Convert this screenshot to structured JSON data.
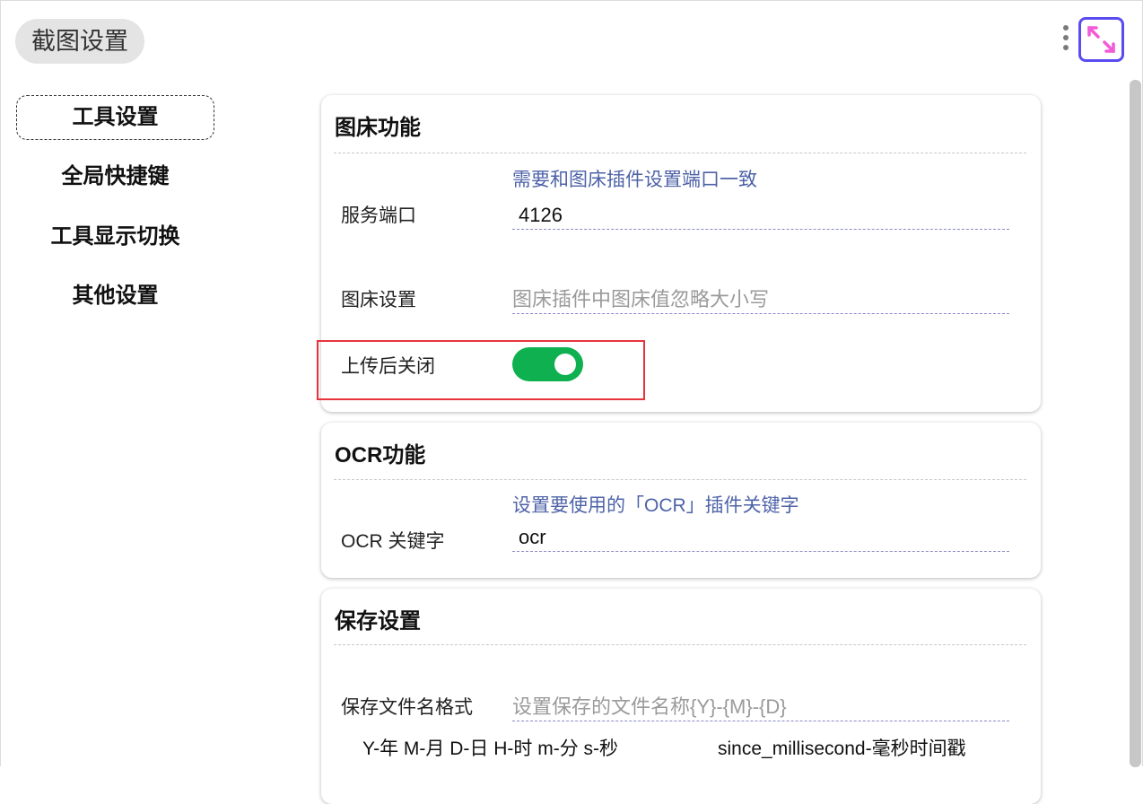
{
  "header": {
    "title": "截图设置"
  },
  "sidebar": {
    "items": [
      {
        "label": "工具设置",
        "active": true
      },
      {
        "label": "全局快捷键",
        "active": false
      },
      {
        "label": "工具显示切换",
        "active": false
      },
      {
        "label": "其他设置",
        "active": false
      }
    ]
  },
  "sections": {
    "image_bed": {
      "title": "图床功能",
      "port_label": "服务端口",
      "port_hint": "需要和图床插件设置端口一致",
      "port_value": "4126",
      "bed_label": "图床设置",
      "bed_placeholder": "图床插件中图床值忽略大小写",
      "close_label": "上传后关闭",
      "close_enabled": true
    },
    "ocr": {
      "title": "OCR功能",
      "keyword_label": "OCR 关键字",
      "keyword_hint": "设置要使用的「OCR」插件关键字",
      "keyword_value": "ocr"
    },
    "save": {
      "title": "保存设置",
      "filename_label": "保存文件名格式",
      "filename_placeholder": "设置保存的文件名称{Y}-{M}-{D}",
      "format_help_left": "Y-年 M-月 D-日 H-时 m-分 s-秒",
      "format_help_right": "since_millisecond-毫秒时间戳"
    }
  },
  "icons": {
    "menu": "more-vertical-icon",
    "expand": "expand-arrows-icon"
  },
  "colors": {
    "accent": "#5b4cf0",
    "toggle_on": "#0eb050",
    "hint": "#4e63a8",
    "highlight": "#e8333c"
  }
}
